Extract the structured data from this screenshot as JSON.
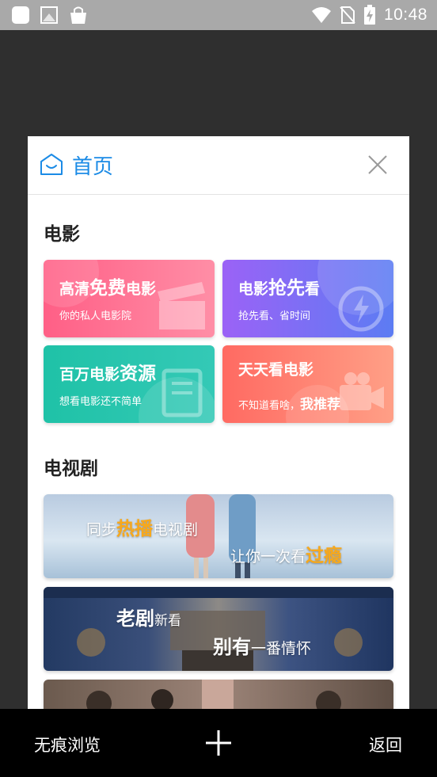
{
  "status_bar": {
    "time": "10:48",
    "icons": [
      "notification-square-icon",
      "image-icon",
      "bag-icon",
      "wifi-icon",
      "no-sim-icon",
      "battery-charging-icon"
    ]
  },
  "card": {
    "title": "首页",
    "sections": {
      "movies": {
        "title": "电影",
        "tiles": [
          {
            "title_pre": "高清",
            "title_big": "免费",
            "title_post": "电影",
            "subtitle": "你的私人电影院",
            "color": "#ff6b8d"
          },
          {
            "title_pre": "电影",
            "title_big": "抢先",
            "title_post": "看",
            "subtitle": "抢先看、省时间",
            "color": "#7f6ef5"
          },
          {
            "title_pre": "百万电影",
            "title_big": "资源",
            "title_post": "",
            "subtitle": "想看电影还不简单",
            "color": "#25c3ab"
          },
          {
            "title_pre": "天天看电影",
            "title_big": "",
            "title_post": "",
            "subtitle_pre": "不知道看啥，",
            "subtitle_big": "我推荐",
            "color": "#ff7f6d"
          }
        ]
      },
      "tv": {
        "title": "电视剧",
        "banners": [
          {
            "line1_pre": "同步",
            "line1_hi": "热播",
            "line1_post": "电视剧",
            "line2_pre": "让你一次看",
            "line2_hi": "过瘾"
          },
          {
            "line1_big": "老剧",
            "line1_post": "新看",
            "line2_big": "别有",
            "line2_post": "一番情怀"
          }
        ]
      }
    }
  },
  "bottom_bar": {
    "incognito_label": "无痕浏览",
    "back_label": "返回"
  },
  "colors": {
    "accent": "#1b8be6",
    "highlight": "#f7a81b"
  }
}
